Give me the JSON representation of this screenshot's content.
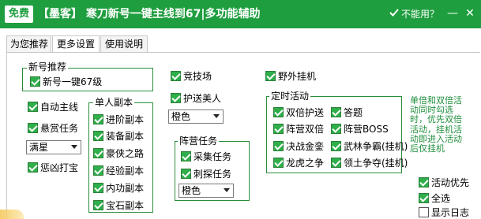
{
  "titlebar": {
    "badge": "免费",
    "title": "【墨客】 寒刀新号一键主线到67|多功能辅助",
    "help": "不能用？",
    "help_icon": "checkmark-icon",
    "minimize_symbol": "—",
    "close_symbol": "✕",
    "accent_color": "#1f9e3f"
  },
  "tabs": [
    "为您推荐",
    "更多设置",
    "使用说明"
  ],
  "active_tab": "更多设置",
  "groups": {
    "new_account": "新号推荐",
    "single_dungeon": "单人副本",
    "faction_task": "阵营任务",
    "timed_event": "定时活动"
  },
  "options": {
    "one_click_67": "新号一键67级",
    "auto_main": "自动主线",
    "bounty": "悬赏任务",
    "punish": "惩凶打宝",
    "arena": "竞技场",
    "escort_beauty": "护送美人",
    "wild_hook": "野外挂机",
    "advanced_dungeon": "进阶副本",
    "equip_dungeon": "装备副本",
    "hero_road": "豪侠之路",
    "exp_dungeon": "经验副本",
    "inner_dungeon": "内功副本",
    "gem_dungeon": "宝石副本",
    "gather_task": "采集任务",
    "scout_task": "刺探任务",
    "double_escort": "双倍护送",
    "answer": "答题",
    "faction_double": "阵营双倍",
    "faction_boss": "阵营BOSS",
    "duel": "决战金銮",
    "wulin": "武林争霸(挂机)",
    "dragon_tiger": "龙虎之争",
    "territory": "领土争夺(挂机)",
    "event_priority": "活动优先",
    "select_all": "全选",
    "show_log": "显示日志"
  },
  "selects": {
    "bounty_level": "满星",
    "escort_color": "橙色",
    "faction_color": "橙色"
  },
  "note": "单倍和双倍活动同时勾选时，优先双倍活动，挂机活动即进入活动后仅挂机"
}
